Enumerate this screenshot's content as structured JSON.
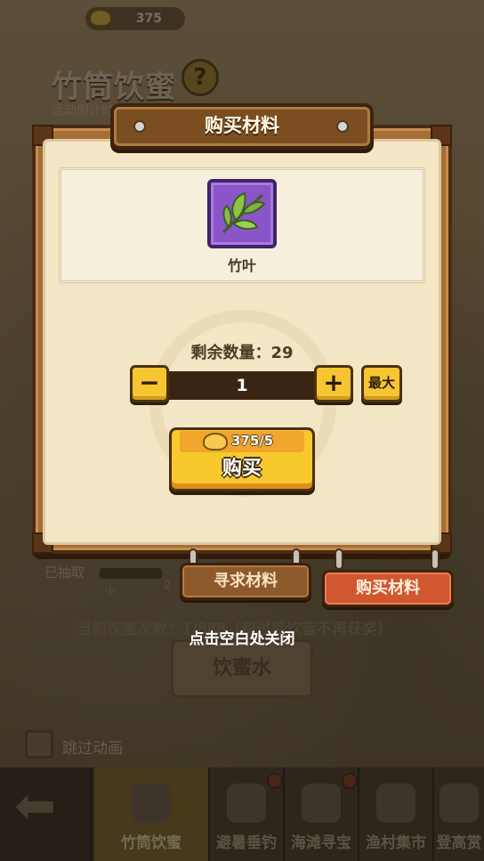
{
  "background": {
    "currency_value": "375",
    "event_title": "竹筒饮蜜",
    "countdown_label": "活动倒计时",
    "drawn_label": "已抽取",
    "progress_small_label": "小",
    "progress_small_num": "2",
    "current_drink_count": "当前饮蜜次数：1/888（超过后饮蜜不再获奖）",
    "drink_button": "饮蜜水",
    "skip_animation": "跳过动画",
    "nav_tabs": [
      {
        "label": "竹筒饮蜜",
        "active": true
      },
      {
        "label": "避暑垂钓",
        "active": false
      },
      {
        "label": "海滩寻宝",
        "active": false
      },
      {
        "label": "渔村集市",
        "active": false
      },
      {
        "label": "登高赏",
        "active": false
      }
    ]
  },
  "dialog": {
    "title": "购买材料",
    "item_name": "竹叶",
    "remaining_label": "剩余数量：29",
    "quantity": "1",
    "minus_label": "−",
    "plus_label": "+",
    "max_label": "最大",
    "cost": "375/5",
    "buy_label": "购买",
    "tabs": {
      "seek": "寻求材料",
      "buy": "购买材料"
    },
    "close_hint": "点击空白处关闭"
  },
  "colors": {
    "accent_yellow": "#f6c531",
    "item_rarity_purple": "#8a55c9",
    "active_tab_red": "#d0572f"
  }
}
